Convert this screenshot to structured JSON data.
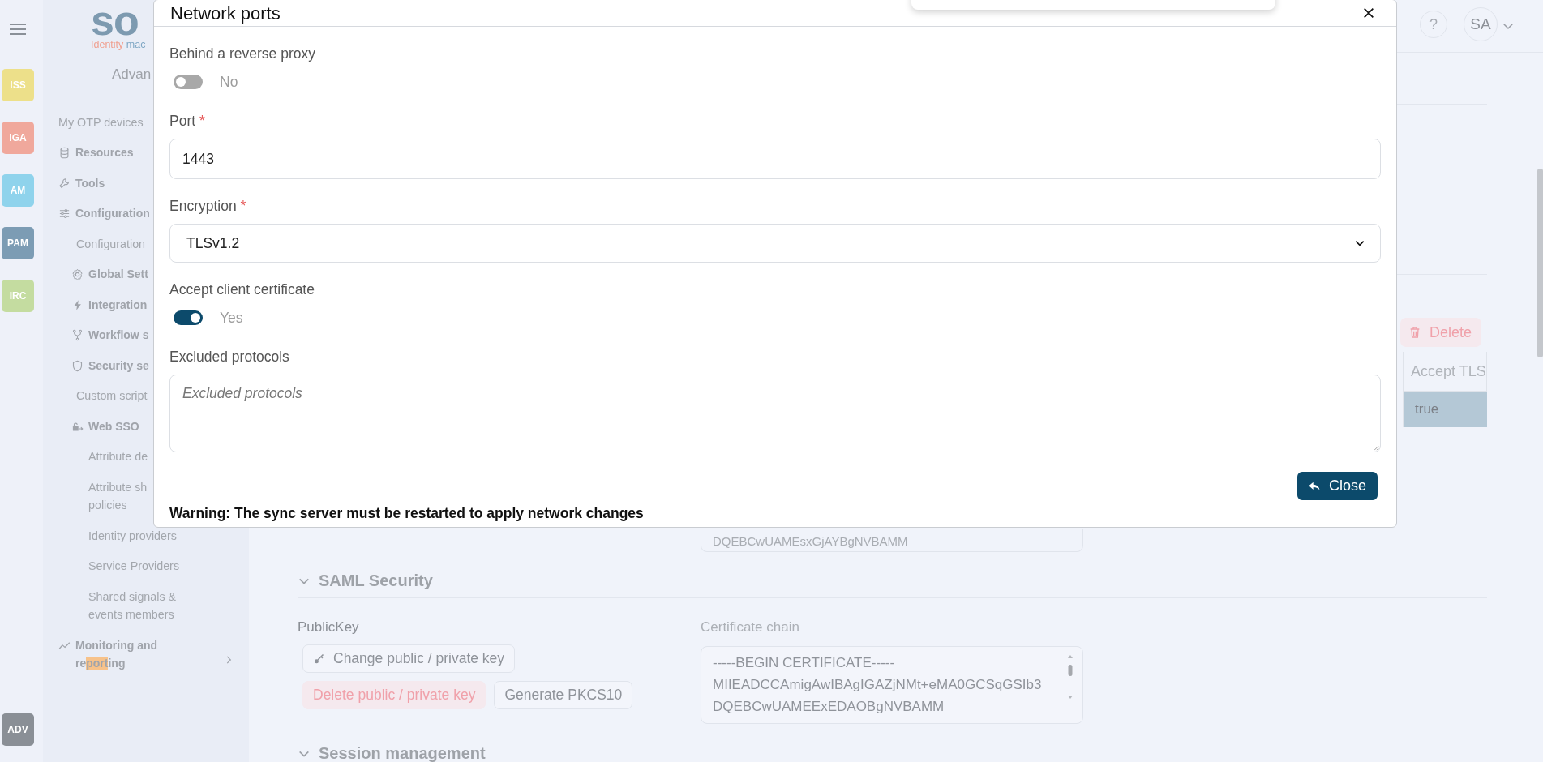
{
  "rail": {
    "badges": [
      {
        "label": "ISS",
        "color": "#ede08a"
      },
      {
        "label": "IGA",
        "color": "#f0a89c"
      },
      {
        "label": "AM",
        "color": "#8fd3ec"
      },
      {
        "label": "PAM",
        "color": "#7c9cb4"
      },
      {
        "label": "IRC",
        "color": "#c4dca0"
      }
    ],
    "bottom_badge": {
      "label": "ADV",
      "color": "#8a8f96"
    }
  },
  "logo": {
    "text": "so",
    "tagline": [
      "Identity",
      "mac"
    ]
  },
  "sidebar": {
    "heading": "Advan",
    "items": [
      {
        "label": "My OTP devices",
        "kind": "plain"
      },
      {
        "label": "Resources",
        "kind": "section"
      },
      {
        "label": "Tools",
        "kind": "section"
      },
      {
        "label": "Configuration",
        "kind": "section",
        "children": [
          {
            "label": "Configuration",
            "kind": "plain"
          },
          {
            "label": "Global Sett",
            "kind": "section"
          },
          {
            "label": "Integration",
            "kind": "section"
          },
          {
            "label": "Workflow s",
            "kind": "section"
          },
          {
            "label": "Security se",
            "kind": "section"
          },
          {
            "label": "Custom script",
            "kind": "plain"
          },
          {
            "label": "Web SSO",
            "kind": "section",
            "children": [
              {
                "label": "Attribute de",
                "kind": "plain"
              },
              {
                "label": "Attribute sh\npolicies",
                "kind": "plain"
              },
              {
                "label": "Identity providers",
                "kind": "plain"
              },
              {
                "label": "Service Providers",
                "kind": "plain"
              },
              {
                "label": "Shared signals &\nevents members",
                "kind": "plain"
              }
            ]
          }
        ]
      },
      {
        "label": [
          {
            "text": "Monitoring and re",
            "highlighted": false
          },
          {
            "text": "port",
            "highlighted": true
          },
          {
            "text": "ing",
            "highlighted": false
          }
        ],
        "kind": "section"
      }
    ]
  },
  "header": {
    "help": "?",
    "avatar": "SA"
  },
  "delete_button": "Delete",
  "table": {
    "columns": [
      "Accept TLS"
    ],
    "rows": [
      {
        "cells": [
          "true"
        ],
        "selected": true
      }
    ]
  },
  "top_field": {
    "value": "DQEBCwUAMEsxGjAYBgNVBAMM"
  },
  "sections": [
    {
      "title": "SAML Security",
      "expanded": true
    },
    {
      "title": "Session management",
      "expanded": true
    }
  ],
  "public_key": {
    "label": "PublicKey",
    "buttons": [
      {
        "label": "Change public / private key",
        "kind": "default"
      },
      {
        "label": "Delete public / private key",
        "kind": "danger"
      },
      {
        "label": "Generate PKCS10",
        "kind": "default"
      }
    ]
  },
  "certificate_chain": {
    "label": "Certificate chain",
    "lines": [
      "-----BEGIN CERTIFICATE-----",
      "MIIEADCCAmigAwIBAgIGAZjNMt+eMA0GCSqGSIb3",
      "DQEBCwUAMEExEDAOBgNVBAMM"
    ]
  },
  "modal": {
    "title": "Network ports",
    "fields": [
      {
        "kind": "toggle",
        "label": "Behind a reverse proxy",
        "on": false,
        "state_text": "No"
      },
      {
        "kind": "text",
        "label": "Port",
        "required_mark": "*",
        "value": "1443"
      },
      {
        "kind": "select",
        "label": "Encryption",
        "required_mark": "*",
        "value": "TLSv1.2"
      },
      {
        "kind": "toggle",
        "label": "Accept client certificate",
        "on": true,
        "state_text": "Yes"
      },
      {
        "kind": "textarea",
        "label": "Excluded protocols",
        "placeholder": "Excluded protocols"
      }
    ],
    "close_button": "Close",
    "warning": "Warning: The sync server must be restarted to apply network changes"
  }
}
